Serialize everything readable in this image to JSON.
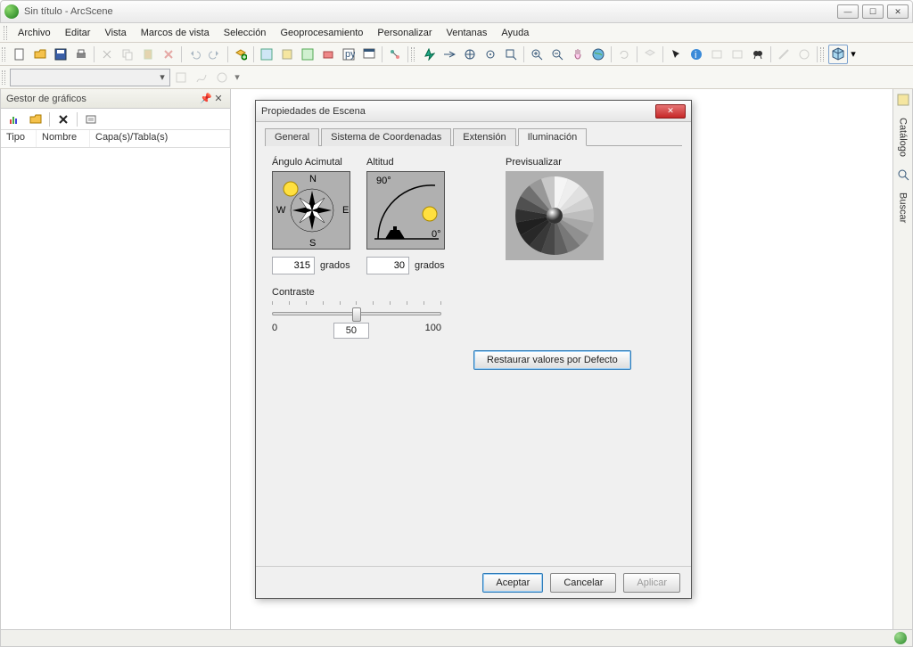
{
  "app": {
    "title": "Sin título - ArcScene"
  },
  "menu": {
    "items": [
      "Archivo",
      "Editar",
      "Vista",
      "Marcos de vista",
      "Selección",
      "Geoprocesamiento",
      "Personalizar",
      "Ventanas",
      "Ayuda"
    ]
  },
  "sidebar": {
    "title": "Gestor de gráficos",
    "columns": [
      "Tipo",
      "Nombre",
      "Capa(s)/Tabla(s)"
    ]
  },
  "rightdock": {
    "items": [
      "Catálogo",
      "Buscar"
    ]
  },
  "dialog": {
    "title": "Propiedades de Escena",
    "tabs": [
      "General",
      "Sistema de Coordenadas",
      "Extensión",
      "Iluminación"
    ],
    "active_tab": 3,
    "illumination": {
      "azimuth_label": "Ángulo Acimutal",
      "azimuth_value": "315",
      "altitude_label": "Altitud",
      "altitude_value": "30",
      "units": "grados",
      "contrast_label": "Contraste",
      "contrast_min": "0",
      "contrast_mid": "50",
      "contrast_max": "100",
      "preview_label": "Previsualizar",
      "restore_label": "Restaurar valores por Defecto",
      "compass": {
        "n": "N",
        "e": "E",
        "s": "S",
        "w": "W"
      },
      "altitude_marks": {
        "top": "90°",
        "right": "0°"
      }
    },
    "buttons": {
      "ok": "Aceptar",
      "cancel": "Cancelar",
      "apply": "Aplicar"
    }
  }
}
